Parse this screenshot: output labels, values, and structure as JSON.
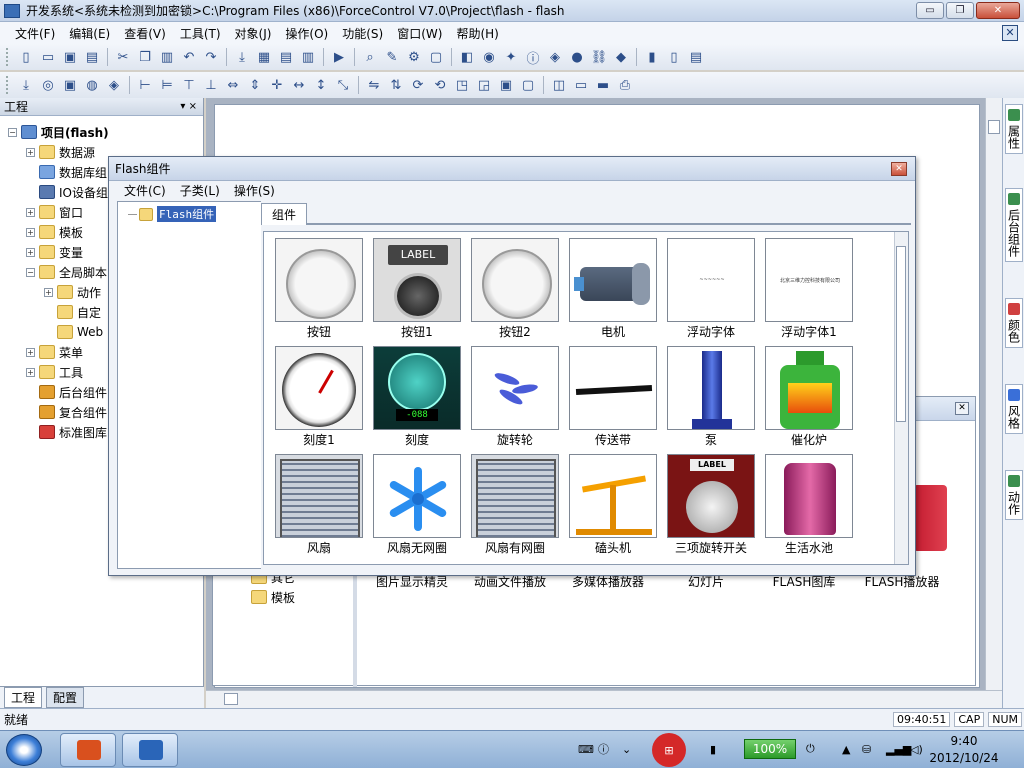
{
  "window": {
    "title": "开发系统<系统未检测到加密锁>C:\\Program Files (x86)\\ForceControl V7.0\\Project\\flash - flash",
    "min_label": "▭",
    "max_label": "❐",
    "close_label": "✕"
  },
  "menu": {
    "items": [
      "文件(F)",
      "编辑(E)",
      "查看(V)",
      "工具(T)",
      "对象(J)",
      "操作(O)",
      "功能(S)",
      "窗口(W)",
      "帮助(H)"
    ],
    "mdi_close": "✕"
  },
  "left_pane": {
    "title": "工程",
    "pin": "▾ ⨯",
    "tree": [
      {
        "label": "项目(flash)",
        "level": 0,
        "exp": "−",
        "icon": "project-icon"
      },
      {
        "label": "数据源",
        "level": 1,
        "exp": "+",
        "icon": "folder-icon"
      },
      {
        "label": "数据库组",
        "level": 1,
        "exp": "",
        "icon": "database-icon"
      },
      {
        "label": "IO设备组",
        "level": 1,
        "exp": "",
        "icon": "network-icon"
      },
      {
        "label": "窗口",
        "level": 1,
        "exp": "+",
        "icon": "folder-icon"
      },
      {
        "label": "模板",
        "level": 1,
        "exp": "+",
        "icon": "folder-icon"
      },
      {
        "label": "变量",
        "level": 1,
        "exp": "+",
        "icon": "folder-icon"
      },
      {
        "label": "全局脚本",
        "level": 1,
        "exp": "−",
        "icon": "folder-icon"
      },
      {
        "label": "动作",
        "level": 2,
        "exp": "+",
        "icon": "folder-icon"
      },
      {
        "label": "自定",
        "level": 2,
        "exp": "",
        "icon": "folder-icon"
      },
      {
        "label": "Web",
        "level": 2,
        "exp": "",
        "icon": "folder-icon"
      },
      {
        "label": "菜单",
        "level": 1,
        "exp": "+",
        "icon": "folder-icon"
      },
      {
        "label": "工具",
        "level": 1,
        "exp": "+",
        "icon": "folder-icon"
      },
      {
        "label": "后台组件",
        "level": 1,
        "exp": "",
        "icon": "component-icon"
      },
      {
        "label": "复合组件",
        "level": 1,
        "exp": "",
        "icon": "component-icon"
      },
      {
        "label": "标准图库",
        "level": 1,
        "exp": "",
        "icon": "library-icon"
      }
    ],
    "tabs": [
      "工程",
      "配置"
    ]
  },
  "back_dialog": {
    "tree_items": [
      "其它",
      "模板"
    ],
    "labels": [
      "图片显示精灵",
      "动画文件播放",
      "多媒体播放器",
      "幻灯片",
      "FLASH图库",
      "FLASH播放器"
    ],
    "close": "✕"
  },
  "right_dock": {
    "tabs": [
      "属性",
      "后台组件",
      "颜色",
      "风格",
      "动作"
    ]
  },
  "flash_dialog": {
    "title": "Flash组件",
    "close": "✕",
    "menu": [
      "文件(C)",
      "子类(L)",
      "操作(S)"
    ],
    "tree_node": "Flash组件",
    "tab": "组件",
    "items": [
      {
        "label": "按钮",
        "kind": "round"
      },
      {
        "label": "按钮1",
        "kind": "label",
        "text": "LABEL"
      },
      {
        "label": "按钮2",
        "kind": "round"
      },
      {
        "label": "电机",
        "kind": "motor"
      },
      {
        "label": "浮动字体",
        "kind": "blank",
        "text": "~~~~~~"
      },
      {
        "label": "浮动字体1",
        "kind": "blank",
        "text": "北京三维力控科技有限公司"
      },
      {
        "label": "刻度1",
        "kind": "gauge"
      },
      {
        "label": "刻度",
        "kind": "dial",
        "text": "-088"
      },
      {
        "label": "旋转轮",
        "kind": "fanblades"
      },
      {
        "label": "传送带",
        "kind": "belt"
      },
      {
        "label": "泵",
        "kind": "pump"
      },
      {
        "label": "催化炉",
        "kind": "furnace"
      },
      {
        "label": "风扇",
        "kind": "grill"
      },
      {
        "label": "风扇无网圈",
        "kind": "fan6"
      },
      {
        "label": "风扇有网圈",
        "kind": "grill"
      },
      {
        "label": "磕头机",
        "kind": "pumpjack"
      },
      {
        "label": "三项旋转开关",
        "kind": "switch",
        "text": "LABEL"
      },
      {
        "label": "生活水池",
        "kind": "tank"
      }
    ]
  },
  "statusbar": {
    "left": "就绪",
    "time": "09:40:51",
    "caps": "CAP",
    "num": "NUM"
  },
  "taskbar": {
    "battery": "100%",
    "clock_time": "9:40",
    "clock_date": "2012/10/24"
  }
}
